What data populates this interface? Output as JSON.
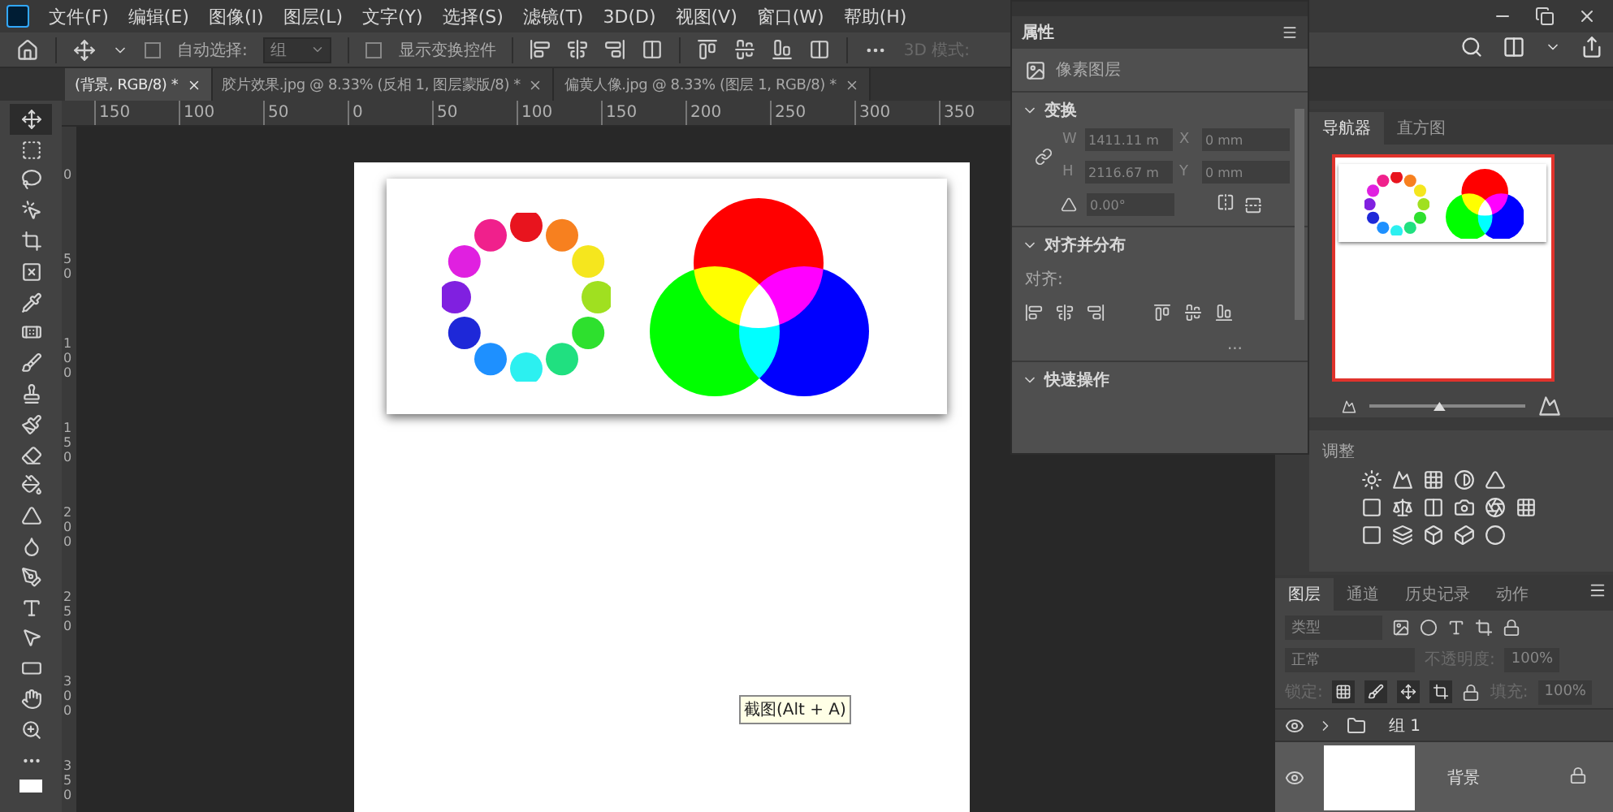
{
  "menu_bar": {
    "items": [
      "文件(F)",
      "编辑(E)",
      "图像(I)",
      "图层(L)",
      "文字(Y)",
      "选择(S)",
      "滤镜(T)",
      "3D(D)",
      "视图(V)",
      "窗口(W)",
      "帮助(H)"
    ]
  },
  "options_bar": {
    "auto_select": {
      "label": "自动选择:",
      "checked": false
    },
    "auto_select_target": "组",
    "show_transform": {
      "label": "显示变换控件",
      "checked": false
    },
    "mode_3d": "3D 模式:"
  },
  "tabs": [
    {
      "label": "(背景, RGB/8) *",
      "selected": true
    },
    {
      "label": "胶片效果.jpg @ 8.33% (反相 1, 图层蒙版/8) *",
      "selected": false
    },
    {
      "label": "偏黄人像.jpg @ 8.33% (图层 1, RGB/8) *",
      "selected": false
    }
  ],
  "rulers": {
    "horizontal": [
      "150",
      "100",
      "50",
      "0",
      "50",
      "100",
      "150",
      "200",
      "250",
      "300",
      "350"
    ],
    "vertical": [
      "0",
      "50",
      "100",
      "150",
      "200",
      "250",
      "300",
      "350"
    ]
  },
  "tools": [
    {
      "kind": "move",
      "selected": true
    },
    {
      "kind": "marquee",
      "selected": false
    },
    {
      "kind": "lasso",
      "selected": false
    },
    {
      "kind": "object",
      "selected": false
    },
    {
      "kind": "crop",
      "selected": false
    },
    {
      "kind": "frame",
      "selected": false
    },
    {
      "kind": "eyedropper",
      "selected": false
    },
    {
      "kind": "healing",
      "selected": false
    },
    {
      "kind": "brush",
      "selected": false
    },
    {
      "kind": "stamp",
      "selected": false
    },
    {
      "kind": "history",
      "selected": false
    },
    {
      "kind": "eraser",
      "selected": false
    },
    {
      "kind": "bucket",
      "selected": false
    },
    {
      "kind": "sharpen",
      "selected": false
    },
    {
      "kind": "blur",
      "selected": false
    },
    {
      "kind": "pen",
      "selected": false
    },
    {
      "kind": "type",
      "selected": false
    },
    {
      "kind": "path",
      "selected": false
    },
    {
      "kind": "rectangle",
      "selected": false
    },
    {
      "kind": "hand",
      "selected": false
    },
    {
      "kind": "zoom",
      "selected": false
    },
    {
      "kind": "more",
      "selected": false
    }
  ],
  "document": {
    "tooltip": "截图(Alt + A)"
  },
  "properties": {
    "title": "属性",
    "layer_type": "像素图层",
    "transform": {
      "title": "变换",
      "expanded": true,
      "fields": [
        {
          "label": "W",
          "value": "1411.11 m"
        },
        {
          "label": "X",
          "value": "0 mm"
        },
        {
          "label": "H",
          "value": "2116.67 m"
        },
        {
          "label": "Y",
          "value": "0 mm"
        }
      ],
      "angle": "0.00°"
    },
    "align": {
      "title": "对齐并分布",
      "expanded": true,
      "label": "对齐:",
      "more": "..."
    },
    "quick": {
      "title": "快速操作",
      "expanded": true
    }
  },
  "navigator": {
    "tabs": [
      {
        "label": "导航器",
        "selected": true
      },
      {
        "label": "直方图",
        "selected": false
      }
    ],
    "zoom": {
      "level": 0.45
    }
  },
  "adjustments": {
    "title": "调整"
  },
  "layers": {
    "tabs": [
      {
        "label": "图层",
        "selected": true
      },
      {
        "label": "通道",
        "selected": false
      },
      {
        "label": "历史记录",
        "selected": false
      },
      {
        "label": "动作",
        "selected": false
      }
    ],
    "filter": "类型",
    "blend_mode": "正常",
    "opacity_label": "不透明度:",
    "opacity": "100%",
    "lock_label": "锁定:",
    "fill_label": "填充:",
    "fill": "100%",
    "items": [
      {
        "kind": "group",
        "name": "组 1",
        "visible": true,
        "selected": false,
        "locked": false
      },
      {
        "kind": "image",
        "name": "背景",
        "visible": true,
        "selected": true,
        "locked": true
      }
    ]
  }
}
